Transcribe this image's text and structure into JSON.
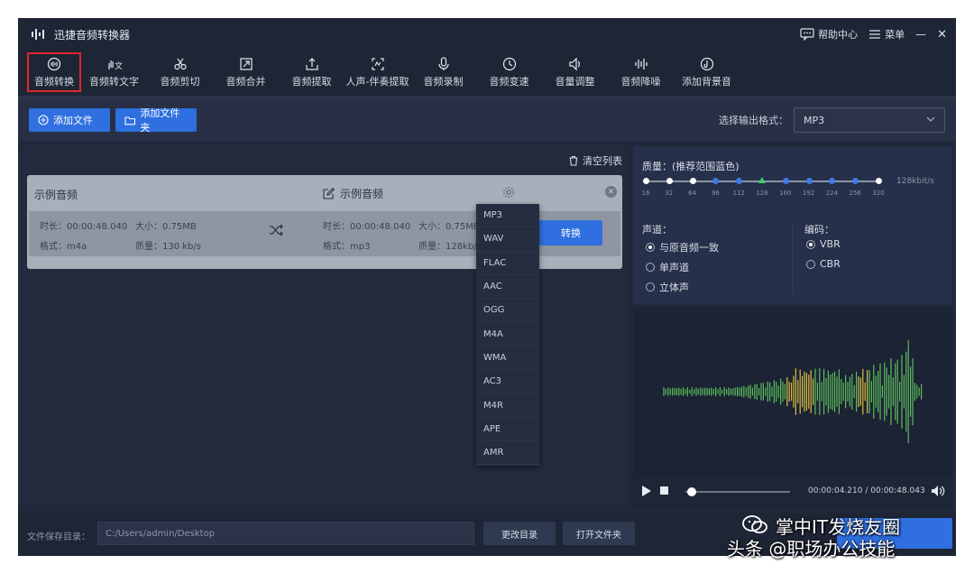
{
  "app": {
    "title": "迅捷音频转换器"
  },
  "titlebar": {
    "help": "帮助中心",
    "menu": "菜单",
    "minimize": "—",
    "close": "✕"
  },
  "toolbar": {
    "tools": [
      {
        "label": "音频转换",
        "icon": "audio-convert-icon"
      },
      {
        "label": "音频转文字",
        "icon": "hand-text-icon"
      },
      {
        "label": "音频剪切",
        "icon": "scissors-icon"
      },
      {
        "label": "音频合并",
        "icon": "merge-icon"
      },
      {
        "label": "音频提取",
        "icon": "upload-icon"
      },
      {
        "label": "人声-伴奏提取",
        "icon": "vocal-icon"
      },
      {
        "label": "音频录制",
        "icon": "microphone-icon"
      },
      {
        "label": "音频变速",
        "icon": "clock-icon"
      },
      {
        "label": "音量调整",
        "icon": "speaker-icon"
      },
      {
        "label": "音频降噪",
        "icon": "denoise-icon"
      },
      {
        "label": "添加背景音",
        "icon": "music-add-icon"
      }
    ]
  },
  "actions": {
    "add_file": "添加文件",
    "add_folder": "添加文件夹",
    "format_label": "选择输出格式：",
    "format_value": "MP3"
  },
  "filelist": {
    "clear_label": "清空列表",
    "source_name": "示例音频",
    "target_name": "示例音频",
    "source_duration": "时长：00:00:48.040",
    "source_size": "大小：0.75MB",
    "source_format": "格式：m4a",
    "source_quality": "质量：130 kb/s",
    "target_duration": "时长：00:00:48.040",
    "target_size": "大小：0.75MB",
    "target_format": "格式：mp3",
    "target_quality": "质量：128kb/",
    "convert_label": "转换"
  },
  "format_dropdown": [
    "MP3",
    "WAV",
    "FLAC",
    "AAC",
    "OGG",
    "M4A",
    "WMA",
    "AC3",
    "M4R",
    "APE",
    "AMR"
  ],
  "settings": {
    "quality_label": "质量：(推荐范围蓝色)",
    "bitrate_ticks": [
      "16",
      "32",
      "64",
      "96",
      "112",
      "128",
      "160",
      "192",
      "224",
      "256",
      "320"
    ],
    "selected_bitrate": "128",
    "bitrate_unit": "128kbit/s",
    "channel_label": "声道：",
    "channels": [
      {
        "label": "与原音频一致",
        "selected": true
      },
      {
        "label": "单声道",
        "selected": false
      },
      {
        "label": "立体声",
        "selected": false
      }
    ],
    "codec_label": "编码：",
    "codecs": [
      {
        "label": "VBR",
        "selected": true
      },
      {
        "label": "CBR",
        "selected": false
      }
    ]
  },
  "player": {
    "time": "00:00:04.210 / 00:00:48.043",
    "progress": 0.02
  },
  "footer": {
    "save_label": "文件保存目录：",
    "save_path": "C:/Users/admin/Desktop",
    "change_dir": "更改目录",
    "open_folder": "打开文件夹"
  },
  "watermark": {
    "line1": "掌中IT发烧友圈",
    "line2": "头条 @职场办公技能"
  },
  "colors": {
    "accent": "#2f6fe0",
    "active_outline": "#e0272e",
    "recommended": "#3f79e6",
    "selected_marker": "#35d06a"
  }
}
